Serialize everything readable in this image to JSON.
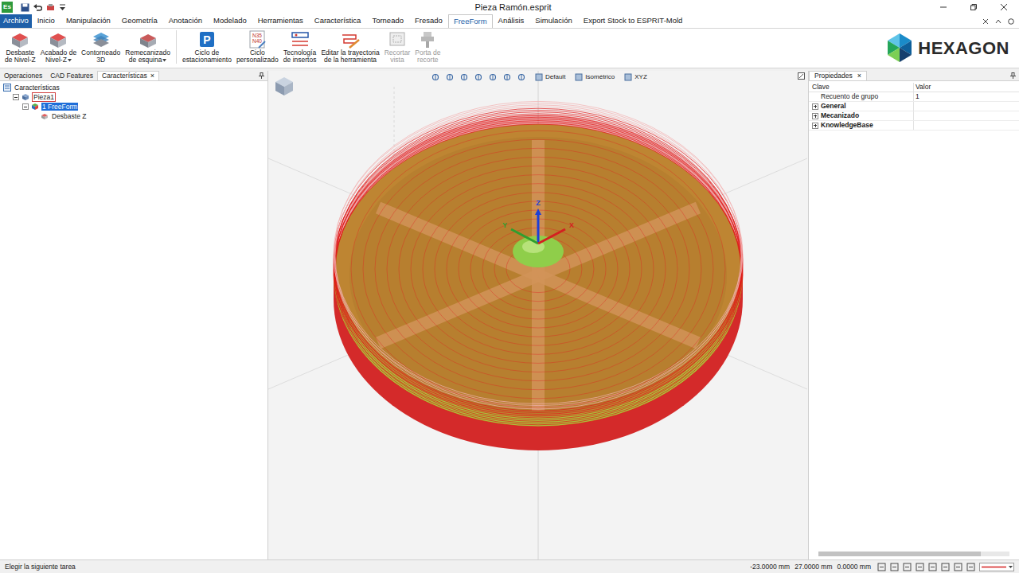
{
  "window": {
    "title": "Pieza Ramón.esprit",
    "app_icon": "Es"
  },
  "menu": [
    {
      "label": "Archivo",
      "kind": "file",
      "selected": false
    },
    {
      "label": "Inicio",
      "kind": "tab",
      "selected": false
    },
    {
      "label": "Manipulación",
      "kind": "tab",
      "selected": false
    },
    {
      "label": "Geometría",
      "kind": "tab",
      "selected": false
    },
    {
      "label": "Anotación",
      "kind": "tab",
      "selected": false
    },
    {
      "label": "Modelado",
      "kind": "tab",
      "selected": false
    },
    {
      "label": "Herramientas",
      "kind": "tab",
      "selected": false
    },
    {
      "label": "Característica",
      "kind": "tab",
      "selected": false
    },
    {
      "label": "Torneado",
      "kind": "tab",
      "selected": false
    },
    {
      "label": "Fresado",
      "kind": "tab",
      "selected": false
    },
    {
      "label": "FreeForm",
      "kind": "tab",
      "selected": true
    },
    {
      "label": "Análisis",
      "kind": "tab",
      "selected": false
    },
    {
      "label": "Simulación",
      "kind": "tab",
      "selected": false
    },
    {
      "label": "Export Stock to ESPRIT-Mold",
      "kind": "tab",
      "selected": false
    }
  ],
  "logo": "HEXAGON",
  "ribbon": [
    {
      "label": [
        "Desbaste",
        "de Nivel-Z"
      ],
      "kind": "solid-red",
      "icon_text": [],
      "dropdown": false,
      "disabled": false,
      "separator_before": false
    },
    {
      "label": [
        "Acabado de",
        "Nivel-Z"
      ],
      "kind": "solid-red",
      "icon_text": [],
      "dropdown": true,
      "disabled": false,
      "separator_before": false
    },
    {
      "label": [
        "Contorneado",
        "3D"
      ],
      "kind": "solid-blue",
      "icon_text": [],
      "dropdown": false,
      "disabled": false,
      "separator_before": false
    },
    {
      "label": [
        "Remecanizado",
        "de esquina"
      ],
      "kind": "solid-grey",
      "icon_text": [],
      "dropdown": true,
      "disabled": false,
      "separator_before": false
    },
    {
      "label": [
        "Ciclo de",
        "estacionamiento"
      ],
      "kind": "badge",
      "icon_text": [
        "P"
      ],
      "dropdown": false,
      "disabled": false,
      "separator_before": true
    },
    {
      "label": [
        "Ciclo",
        "personalizado"
      ],
      "kind": "nc-code",
      "icon_text": [
        "N35",
        "N40"
      ],
      "dropdown": false,
      "disabled": false,
      "separator_before": false
    },
    {
      "label": [
        "Tecnología",
        "de insertos"
      ],
      "kind": "insert",
      "icon_text": [],
      "dropdown": false,
      "disabled": false,
      "separator_before": false
    },
    {
      "label": [
        "Editar la trayectoria",
        "de la herramienta"
      ],
      "kind": "edit-path",
      "icon_text": [],
      "dropdown": false,
      "disabled": false,
      "separator_before": false
    },
    {
      "label": [
        "Recortar",
        "vista"
      ],
      "kind": "trim",
      "icon_text": [],
      "dropdown": false,
      "disabled": true,
      "separator_before": false
    },
    {
      "label": [
        "Porta de",
        "recorte"
      ],
      "kind": "holder",
      "icon_text": [],
      "dropdown": false,
      "disabled": true,
      "separator_before": false
    }
  ],
  "left_panel": {
    "close_glyph": "×",
    "tabs": [
      {
        "label": "Operaciones",
        "selected": false,
        "closable": false
      },
      {
        "label": "CAD Features",
        "selected": false,
        "closable": false
      },
      {
        "label": "Características",
        "selected": true,
        "closable": true
      }
    ],
    "tree": [
      {
        "label": "Características",
        "level": 0,
        "kind": "root",
        "has_children": false,
        "expanded": false,
        "selected": false,
        "focused": false
      },
      {
        "label": "Pieza1",
        "level": 1,
        "kind": "part",
        "has_children": true,
        "expanded": true,
        "selected": false,
        "focused": true
      },
      {
        "label": "1 FreeForm",
        "level": 2,
        "kind": "feature",
        "has_children": true,
        "expanded": true,
        "selected": true,
        "focused": false
      },
      {
        "label": "Desbaste Z",
        "level": 3,
        "kind": "operation",
        "has_children": false,
        "expanded": false,
        "selected": false,
        "focused": false
      }
    ]
  },
  "viewport": {
    "toolbar": [
      "Default",
      "Isométrico",
      "XYZ"
    ],
    "axes": [
      {
        "label": "Z",
        "color": "#1c3fd8"
      },
      {
        "label": "Y",
        "color": "#2f9e2f"
      },
      {
        "label": "X",
        "color": "#d42020"
      }
    ]
  },
  "properties": {
    "title": "Propiedades",
    "close_glyph": "×",
    "columns": [
      "Clave",
      "Valor"
    ],
    "rows": [
      {
        "key": "Recuento de grupo",
        "value": "1",
        "expandable": false,
        "expanded": false
      },
      {
        "key": "General",
        "value": "",
        "expandable": true,
        "expanded": false
      },
      {
        "key": "Mecanizado",
        "value": "",
        "expandable": true,
        "expanded": false
      },
      {
        "key": "KnowledgeBase",
        "value": "",
        "expandable": true,
        "expanded": false
      }
    ]
  },
  "status_bar": {
    "message": "Elegir la siguiente tarea",
    "coords": [
      "-23.0000 mm",
      "27.0000 mm",
      "0.0000 mm"
    ]
  }
}
